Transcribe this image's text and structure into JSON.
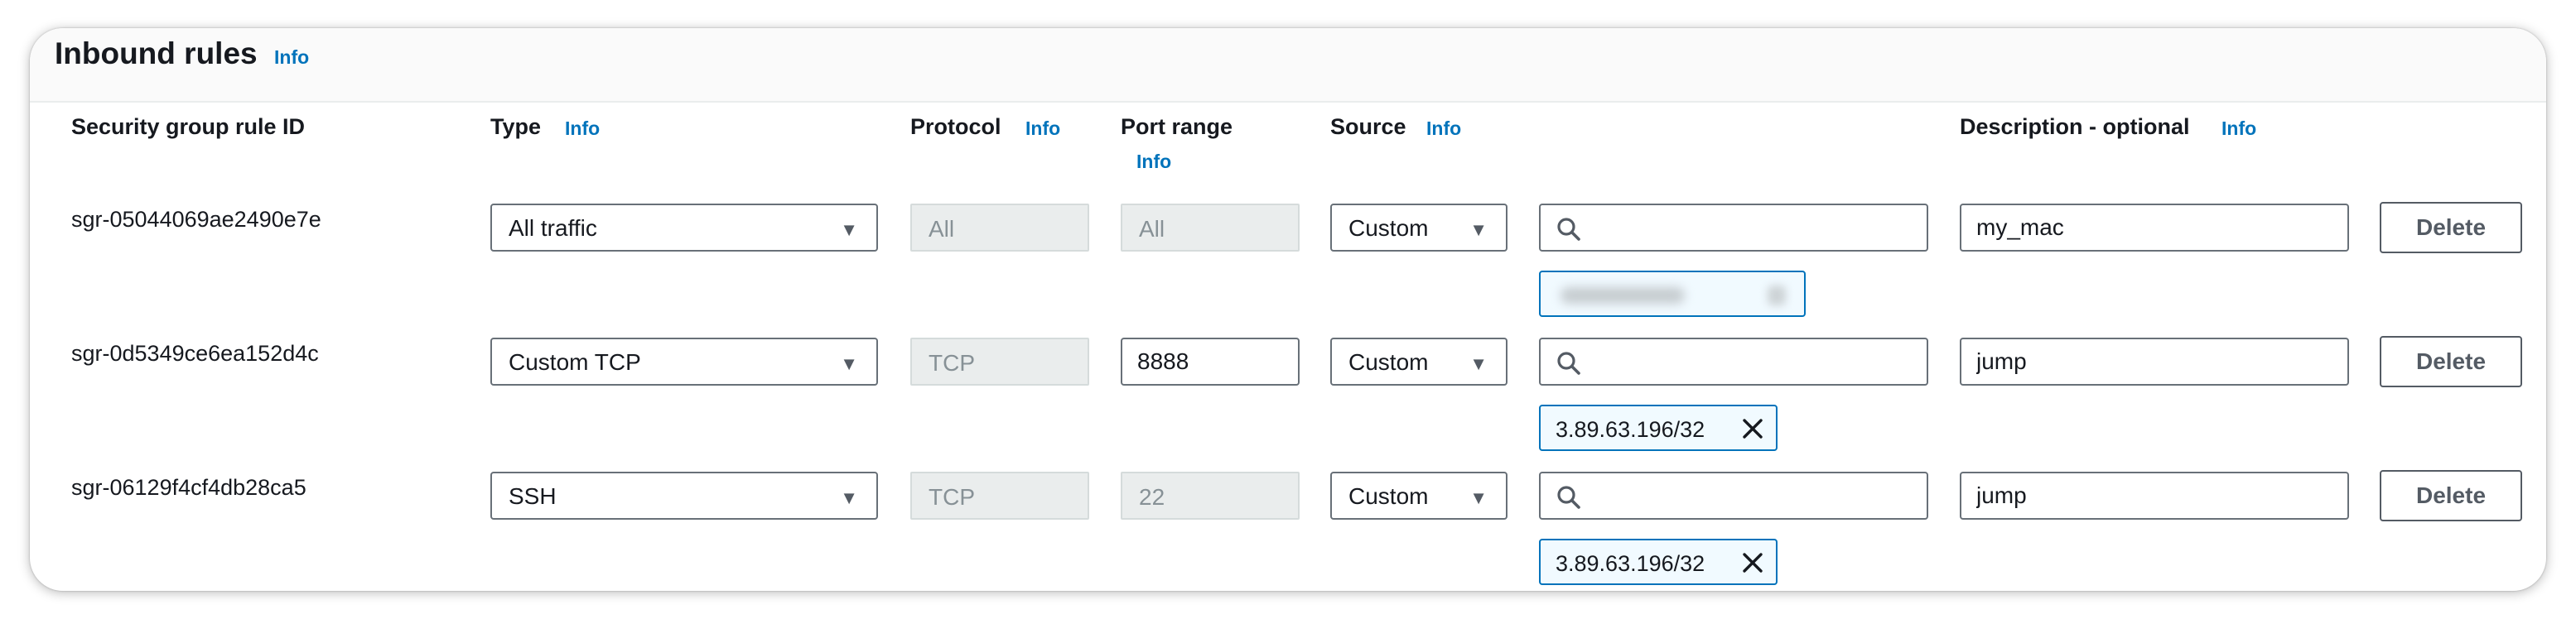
{
  "section": {
    "title": "Inbound rules",
    "info": "Info"
  },
  "columns": {
    "rule_id": "Security group rule ID",
    "type": "Type",
    "protocol": "Protocol",
    "port_range": "Port range",
    "source": "Source",
    "description": "Description - optional",
    "info": "Info"
  },
  "rules": [
    {
      "id": "sgr-05044069ae2490e7e",
      "type": "All traffic",
      "protocol": "All",
      "port_range": "All",
      "source_type": "Custom",
      "source_search": "",
      "source_token": "",
      "description": "my_mac",
      "delete_label": "Delete"
    },
    {
      "id": "sgr-0d5349ce6ea152d4c",
      "type": "Custom TCP",
      "protocol": "TCP",
      "port_range": "8888",
      "source_type": "Custom",
      "source_search": "",
      "source_token": "3.89.63.196/32",
      "description": "jump",
      "delete_label": "Delete"
    },
    {
      "id": "sgr-06129f4cf4db28ca5",
      "type": "SSH",
      "protocol": "TCP",
      "port_range": "22",
      "source_type": "Custom",
      "source_search": "",
      "source_token": "3.89.63.196/32",
      "description": "jump",
      "delete_label": "Delete"
    }
  ],
  "colors": {
    "link_blue": "#0073bb",
    "token_bg": "#f1faff",
    "disabled_bg": "#eaeded",
    "text": "#16191f"
  },
  "icons": [
    "search-icon",
    "caret-down-icon",
    "close-icon",
    "info-link"
  ]
}
